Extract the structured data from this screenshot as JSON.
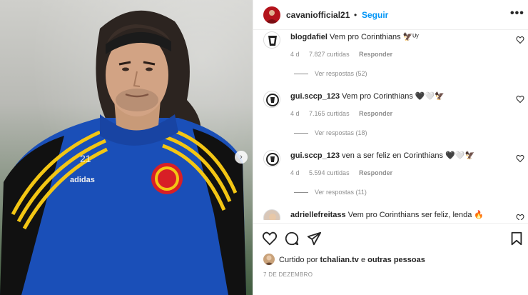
{
  "post": {
    "author": "cavaniofficial21",
    "separator": "•",
    "follow_label": "Seguir",
    "more_label": "•••",
    "jersey_number": "21",
    "jersey_brand": "adidas"
  },
  "comments": [
    {
      "user": "blogdafiel",
      "text": "Vem pro Corinthians 🦅ᵁʸ",
      "age": "4 d",
      "likes": "7.827 curtidas",
      "reply_label": "Responder",
      "view_replies": "Ver respostas (52)"
    },
    {
      "user": "gui.sccp_123",
      "text": "Vem pro Corinthians 🖤🤍🦅",
      "age": "4 d",
      "likes": "7.165 curtidas",
      "reply_label": "Responder",
      "view_replies": "Ver respostas (18)"
    },
    {
      "user": "gui.sccp_123",
      "text": "ven a ser feliz en Corinthians 🖤🤍🦅",
      "age": "4 d",
      "likes": "5.594 curtidas",
      "reply_label": "Responder",
      "view_replies": "Ver respostas (11)"
    },
    {
      "user": "adriellefreitass",
      "text": "Vem pro Corinthians ser feliz, lenda 🔥"
    }
  ],
  "likes_line": {
    "prefix": "Curtido por",
    "user": "tchalian.tv",
    "middle": "e",
    "suffix": "outras pessoas"
  },
  "date": "7 DE DEZEMBRO",
  "icons": {
    "like": "heart-icon",
    "comment": "comment-icon",
    "share": "share-icon",
    "save": "bookmark-icon",
    "more": "more-icon",
    "next": "chevron-right-icon"
  },
  "colors": {
    "follow": "#0095f6",
    "jersey": "#1a4fb8",
    "stripe": "#f3c614"
  }
}
